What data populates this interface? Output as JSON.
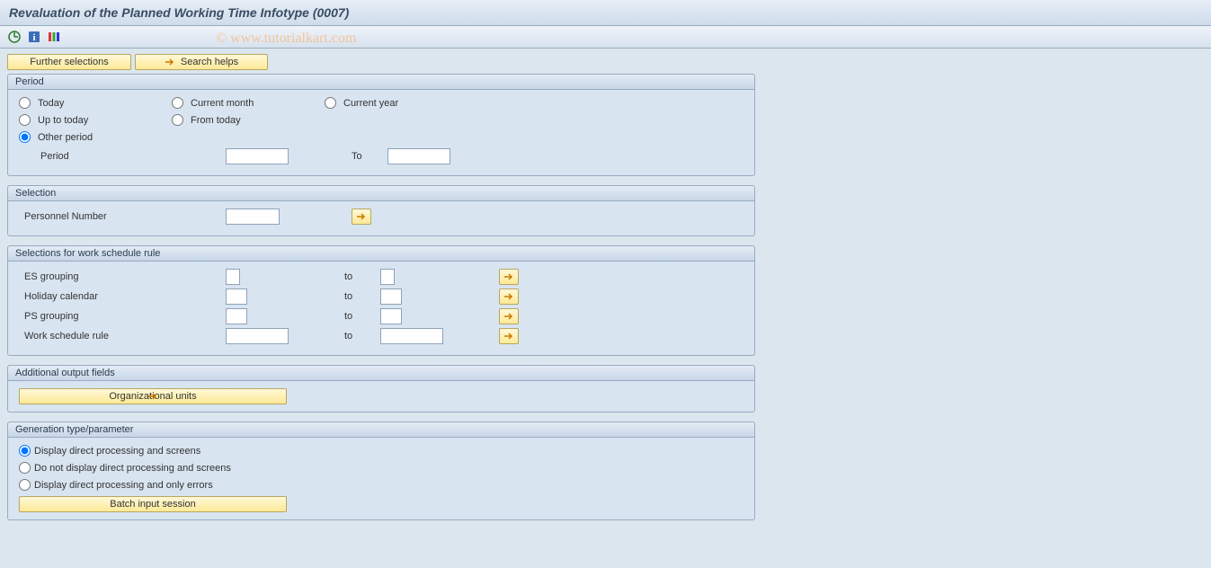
{
  "title": "Revaluation of the Planned Working Time Infotype (0007)",
  "watermark": "© www.tutorialkart.com",
  "top_buttons": {
    "further_selections": "Further selections",
    "search_helps": "Search helps"
  },
  "period": {
    "header": "Period",
    "today": "Today",
    "current_month": "Current month",
    "current_year": "Current year",
    "up_to_today": "Up to today",
    "from_today": "From today",
    "other_period": "Other period",
    "period_label": "Period",
    "to_label": "To",
    "period_from_value": "",
    "period_to_value": ""
  },
  "selection": {
    "header": "Selection",
    "personnel_number": "Personnel Number",
    "personnel_number_value": ""
  },
  "ws_rule": {
    "header": "Selections for work schedule rule",
    "to_label": "to",
    "es_grouping": "ES grouping",
    "holiday_calendar": "Holiday calendar",
    "ps_grouping": "PS grouping",
    "work_schedule_rule": "Work schedule rule",
    "es_from": "",
    "es_to": "",
    "hc_from": "",
    "hc_to": "",
    "ps_from": "",
    "ps_to": "",
    "wsr_from": "",
    "wsr_to": ""
  },
  "additional_output": {
    "header": "Additional output fields",
    "org_units": "Organizational units"
  },
  "generation": {
    "header": "Generation type/parameter",
    "opt1": "Display direct processing and screens",
    "opt2": "Do not display direct processing and screens",
    "opt3": "Display direct processing and only errors",
    "batch_input": "Batch input session"
  }
}
